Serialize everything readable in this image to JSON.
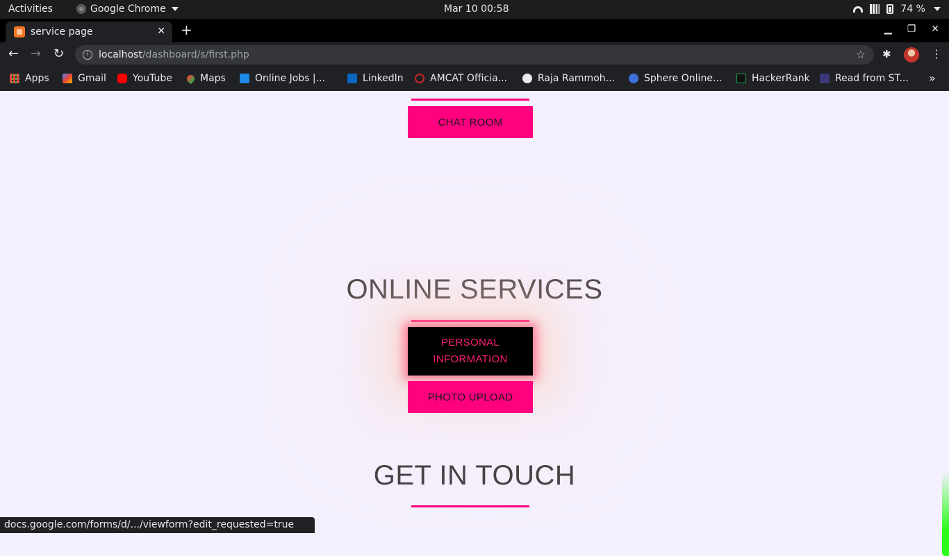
{
  "system_bar": {
    "activities": "Activities",
    "app_name": "Google Chrome",
    "datetime": "Mar 10  00:58",
    "battery": "74 %"
  },
  "browser": {
    "tab_title": "service page",
    "url_host": "localhost",
    "url_path": "/dashboard/s/first.php",
    "bookmarks": [
      {
        "label": "Apps",
        "icon": "apps-grid-icon",
        "color": "#e34b3f"
      },
      {
        "label": "Gmail",
        "icon": "gmail-icon",
        "color": "#ea4335"
      },
      {
        "label": "YouTube",
        "icon": "youtube-icon",
        "color": "#ff0000"
      },
      {
        "label": "Maps",
        "icon": "maps-pin-icon",
        "color": "#34a853"
      },
      {
        "label": "Online Jobs |...",
        "icon": "online-jobs-icon",
        "color": "#1e88e5"
      },
      {
        "label": "LinkedIn",
        "icon": "linkedin-icon",
        "color": "#0a66c2"
      },
      {
        "label": "AMCAT Officia...",
        "icon": "amcat-icon",
        "color": "#c62828"
      },
      {
        "label": "Raja Rammoh...",
        "icon": "globe-icon",
        "color": "#e8eaed"
      },
      {
        "label": "Sphere Online...",
        "icon": "sphere-icon",
        "color": "#3f6fd8"
      },
      {
        "label": "HackerRank",
        "icon": "hackerrank-icon",
        "color": "#1ba94c"
      },
      {
        "label": "Read from ST...",
        "icon": "read-icon",
        "color": "#3a3a7a"
      }
    ]
  },
  "page": {
    "chat_room_button": "CHAT ROOM",
    "online_services_heading": "ONLINE SERVICES",
    "personal_info_button": "PERSONAL INFORMATION",
    "photo_upload_button": "PHOTO UPLOAD",
    "get_in_touch_heading": "GET IN TOUCH",
    "accent_color": "#ff007f"
  },
  "status_url": "docs.google.com/forms/d/.../viewform?edit_requested=true"
}
